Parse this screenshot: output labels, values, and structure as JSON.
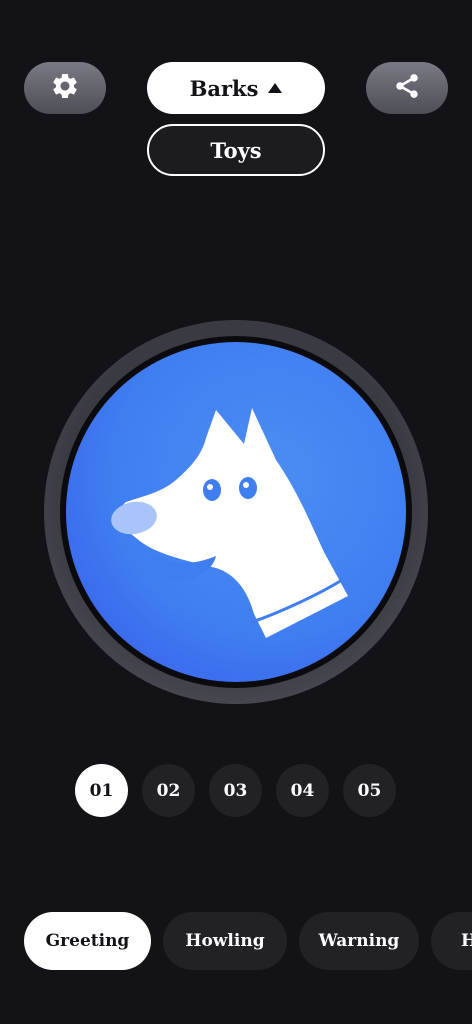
{
  "top_bar": {
    "settings_icon": "gear-icon",
    "share_icon": "share-icon",
    "mode_selected": "Barks",
    "mode_other": "Toys"
  },
  "sound_button": {
    "icon": "dog-head-icon",
    "colors": {
      "button": "#3f7ef1",
      "dog": "#ffffff",
      "nose": "#a9c4fb"
    }
  },
  "sound_numbers": [
    {
      "label": "01",
      "active": true
    },
    {
      "label": "02",
      "active": false
    },
    {
      "label": "03",
      "active": false
    },
    {
      "label": "04",
      "active": false
    },
    {
      "label": "05",
      "active": false
    }
  ],
  "categories": [
    {
      "label": "Greeting",
      "active": true
    },
    {
      "label": "Howling",
      "active": false
    },
    {
      "label": "Warning",
      "active": false
    },
    {
      "label": "H",
      "active": false
    }
  ],
  "colors": {
    "background": "#131216",
    "pill": "#222126",
    "active_pill": "#ffffff"
  }
}
